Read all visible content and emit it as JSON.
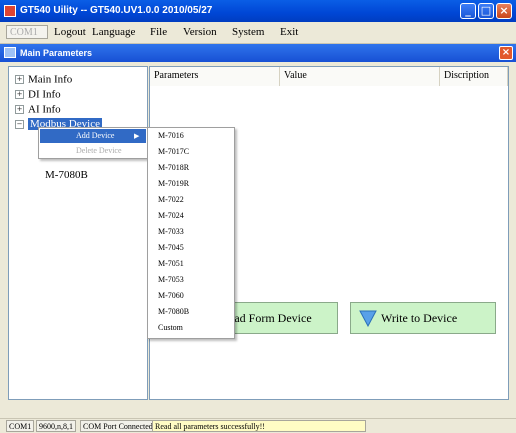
{
  "window": {
    "title": "GT540 Uility -- GT540.UV1.0.0 2010/05/27",
    "minimize_glyph": "_",
    "maximize_glyph": "□",
    "close_glyph": "×"
  },
  "menubar": {
    "com_port": "COM1",
    "items": [
      "Logout",
      "Language",
      "File",
      "Version",
      "System",
      "Exit"
    ]
  },
  "panel": {
    "title": "Main Parameters",
    "close_glyph": "×"
  },
  "tree": {
    "nodes": [
      {
        "label": "Main Info",
        "expander": "+"
      },
      {
        "label": "DI Info",
        "expander": "+"
      },
      {
        "label": "AI Info",
        "expander": "+"
      },
      {
        "label": "Modbus Device",
        "expander": "−"
      }
    ],
    "children": [
      "M-7080B"
    ]
  },
  "grid": {
    "columns": [
      "Parameters",
      "Value",
      "Discription"
    ]
  },
  "context_menu": {
    "items": [
      {
        "label": "Add Device",
        "arrow": "▶"
      },
      {
        "label": "Delete Device"
      }
    ]
  },
  "submenu": {
    "items": [
      "M-7016",
      "M-7017C",
      "M-7018R",
      "M-7019R",
      "M-7022",
      "M-7024",
      "M-7033",
      "M-7045",
      "M-7051",
      "M-7053",
      "M-7060",
      "M-7080B",
      "Custom"
    ]
  },
  "buttons": {
    "read_label": "Read Form Device",
    "write_label": "Write to Device"
  },
  "statusbar": {
    "port": "COM1",
    "settings": "9600,n,8,1",
    "connection": "COM Port Connected",
    "message": "Read all parameters successfully!!"
  },
  "colors": {
    "titlebar": "#0a5ee6",
    "selection": "#316ac5",
    "button_bg": "#ccf3c8",
    "up_arrow": "#2a86d8",
    "down_arrow": "#58a0e8"
  }
}
